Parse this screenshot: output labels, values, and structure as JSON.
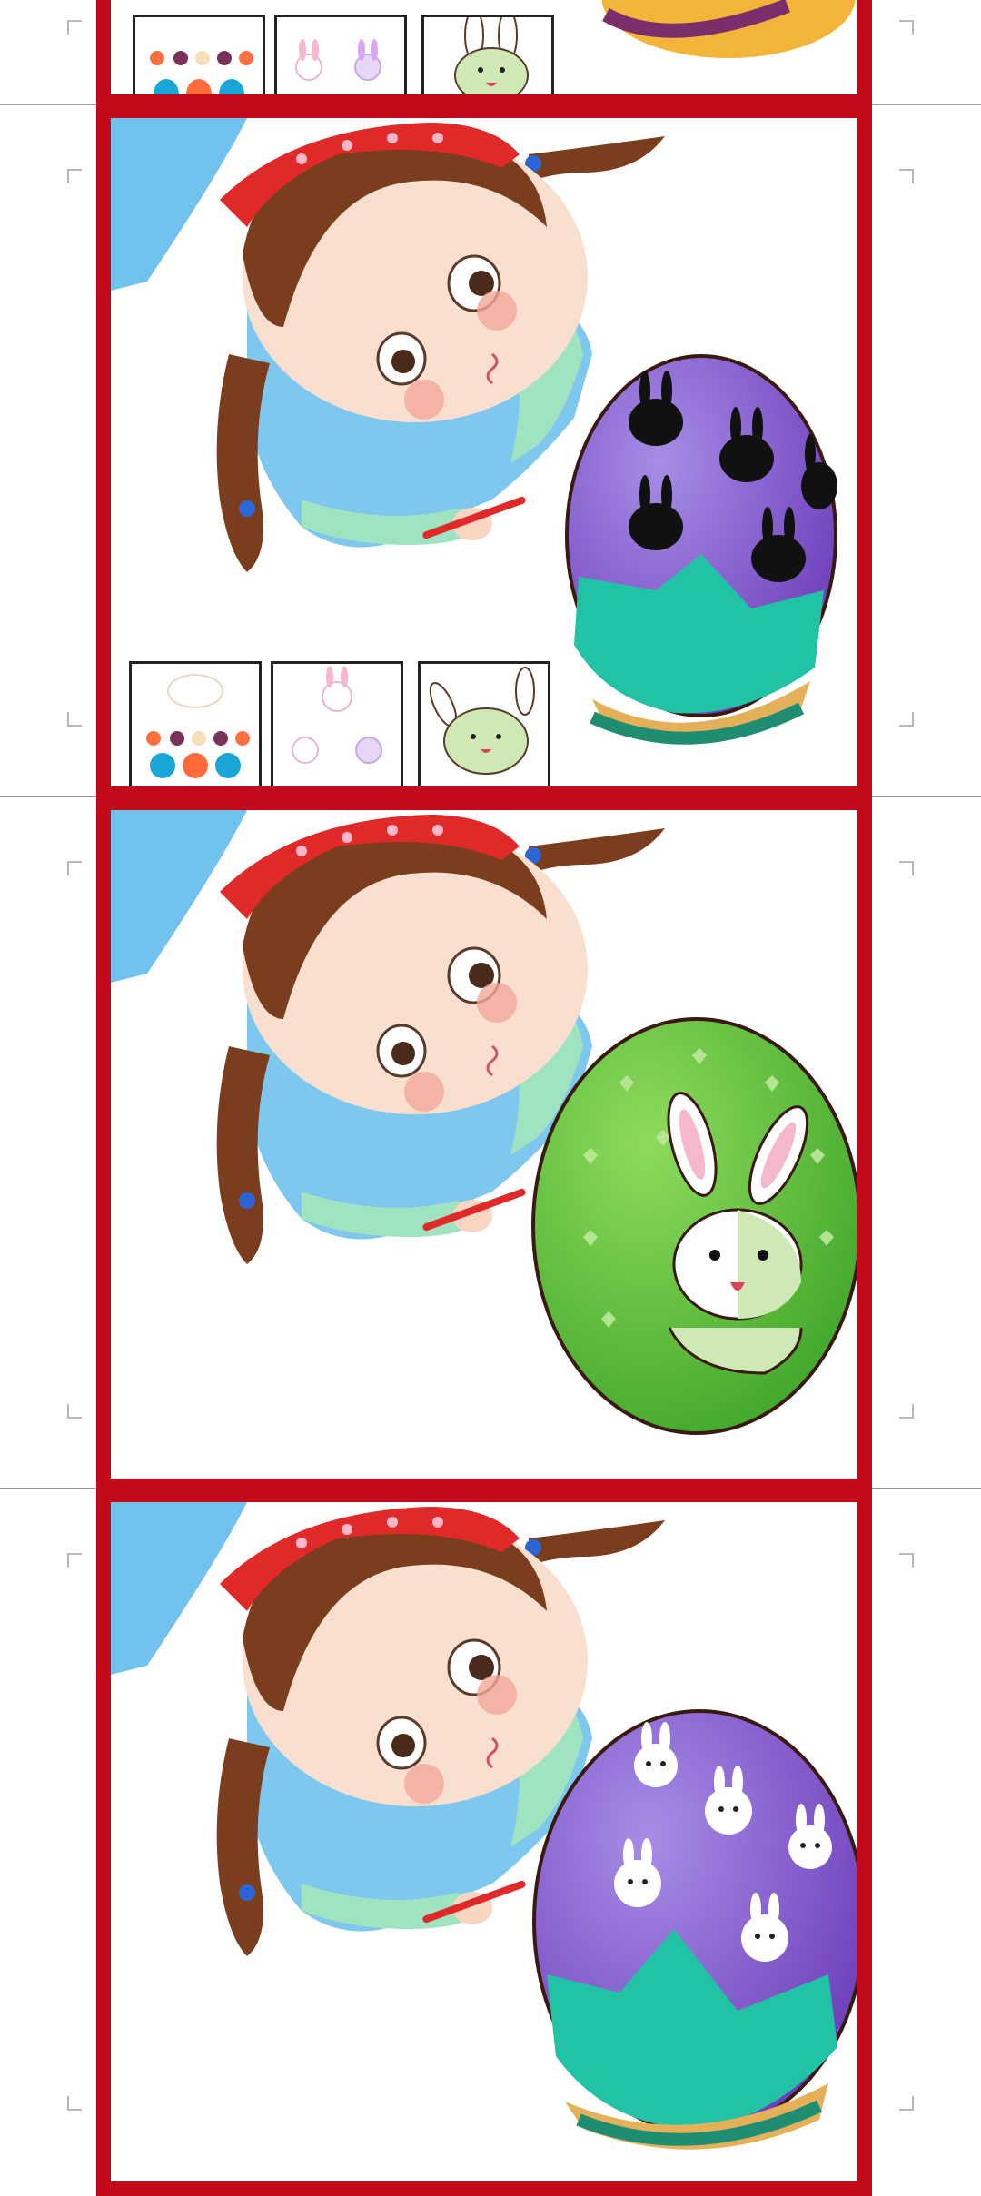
{
  "viewer": {
    "pages": [
      {
        "id": "slide-1",
        "egg": "partial",
        "thumbnails": [
          "bunny-with-dots",
          "bunny-faces",
          "green-bunny"
        ]
      },
      {
        "id": "slide-2",
        "egg": "purple-with-black-bunny-silhouettes",
        "thumbnails": [
          "bunny-with-dots",
          "bunny-faces",
          "green-bunny"
        ]
      },
      {
        "id": "slide-3",
        "egg": "green-heart-egg-with-bunny"
      },
      {
        "id": "slide-4",
        "egg": "purple-egg-with-bunny-faces"
      }
    ]
  },
  "colors": {
    "frame": "#c4091a",
    "purple_egg": "#7e4fc6",
    "green_egg": "#5fbf2c",
    "teal": "#21c3a3",
    "sky": "#6fc0ee"
  }
}
